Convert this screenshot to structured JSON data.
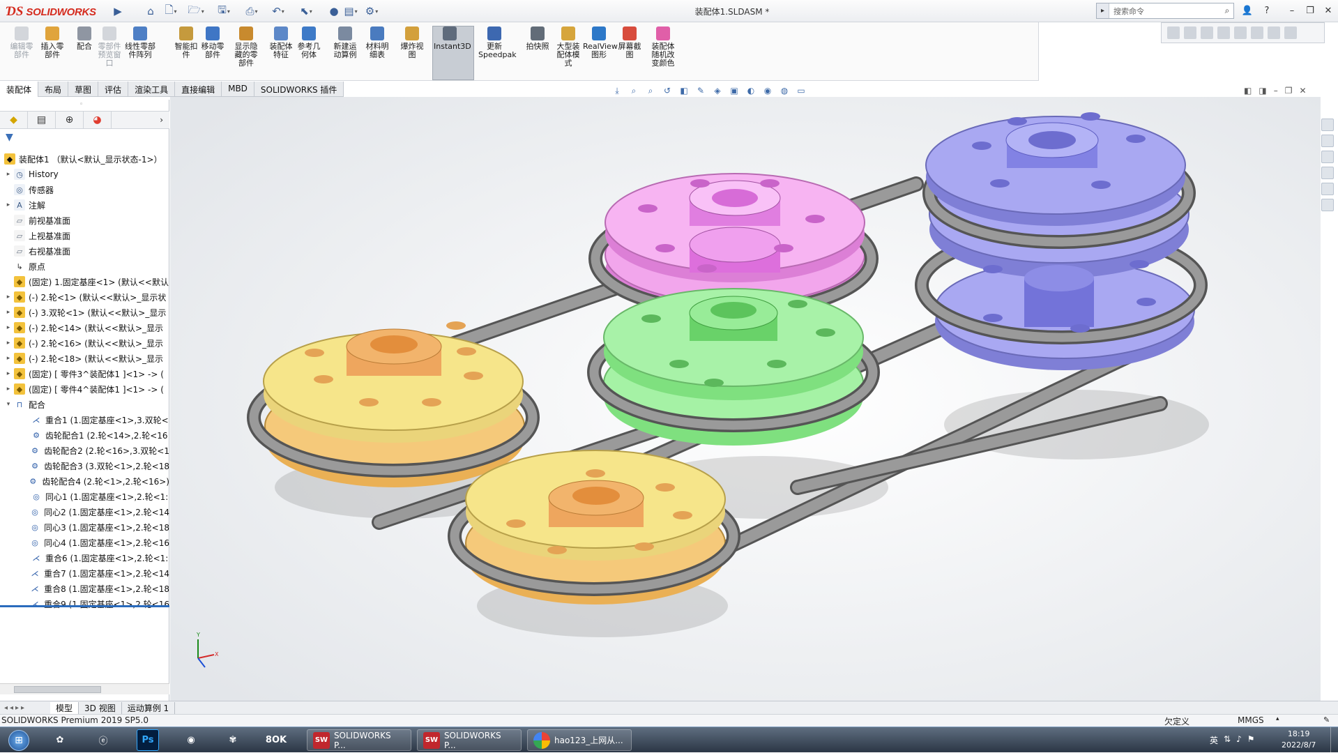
{
  "app": {
    "logo_text": "SOLIDWORKS",
    "document_title": "装配体1.SLDASM *",
    "search_placeholder": "搜索命令"
  },
  "ribbon": {
    "buttons": [
      {
        "label": "编辑零\n部件",
        "icon": "edit-component-icon",
        "disabled": true
      },
      {
        "label": "插入零\n部件",
        "icon": "insert-component-icon",
        "disabled": false
      },
      {
        "label": "配合",
        "icon": "mate-icon",
        "disabled": false
      },
      {
        "label": "零部件\n预览窗\n口",
        "icon": "component-preview-icon",
        "disabled": true
      },
      {
        "label": "线性零部\n件阵列",
        "icon": "linear-pattern-icon",
        "disabled": false
      },
      {
        "label": "智能扣\n件",
        "icon": "smart-fasteners-icon",
        "disabled": false
      },
      {
        "label": "移动零\n部件",
        "icon": "move-component-icon",
        "disabled": false
      },
      {
        "label": "显示隐\n藏的零\n部件",
        "icon": "show-hidden-icon",
        "disabled": false
      },
      {
        "label": "装配体\n特征",
        "icon": "assembly-features-icon",
        "disabled": false
      },
      {
        "label": "参考几\n何体",
        "icon": "reference-geometry-icon",
        "disabled": false
      },
      {
        "label": "新建运\n动算例",
        "icon": "new-motion-study-icon",
        "disabled": false
      },
      {
        "label": "材料明\n细表",
        "icon": "bill-of-materials-icon",
        "disabled": false
      },
      {
        "label": "爆炸视\n图",
        "icon": "exploded-view-icon",
        "disabled": false
      },
      {
        "label": "Instant3D",
        "icon": "instant3d-icon",
        "disabled": false
      },
      {
        "label": "更新\nSpeedpak",
        "icon": "speedpak-icon",
        "disabled": false
      },
      {
        "label": "拍快照",
        "icon": "snapshot-icon",
        "disabled": false
      },
      {
        "label": "大型装\n配体模\n式",
        "icon": "large-assembly-icon",
        "disabled": false
      },
      {
        "label": "RealView\n图形",
        "icon": "realview-icon",
        "disabled": false
      },
      {
        "label": "屏幕截\n图",
        "icon": "screen-capture-icon",
        "disabled": false
      },
      {
        "label": "装配体\n随机改\n变颜色",
        "icon": "random-color-icon",
        "disabled": false
      }
    ]
  },
  "command_tabs": [
    "装配体",
    "布局",
    "草图",
    "评估",
    "渲染工具",
    "直接编辑",
    "MBD",
    "SOLIDWORKS 插件"
  ],
  "tree": {
    "root": "装配体1 （默认<默认_显示状态-1>）",
    "items": [
      {
        "label": "History",
        "icon": "history-icon",
        "indent": 1,
        "expander": "▸"
      },
      {
        "label": "传感器",
        "icon": "sensor-icon",
        "indent": 1,
        "expander": ""
      },
      {
        "label": "注解",
        "icon": "annotation-icon",
        "indent": 1,
        "expander": "▸"
      },
      {
        "label": "前视基准面",
        "icon": "plane-icon",
        "indent": 1,
        "expander": ""
      },
      {
        "label": "上视基准面",
        "icon": "plane-icon",
        "indent": 1,
        "expander": ""
      },
      {
        "label": "右视基准面",
        "icon": "plane-icon",
        "indent": 1,
        "expander": ""
      },
      {
        "label": "原点",
        "icon": "origin-icon",
        "indent": 1,
        "expander": ""
      },
      {
        "label": "(固定) 1.固定基座<1> (默认<<默认",
        "icon": "part-icon",
        "indent": 1,
        "expander": ""
      },
      {
        "label": "(-) 2.轮<1> (默认<<默认>_显示状",
        "icon": "part-icon",
        "indent": 1,
        "expander": "▸"
      },
      {
        "label": "(-) 3.双轮<1> (默认<<默认>_显示",
        "icon": "part-icon",
        "indent": 1,
        "expander": "▸"
      },
      {
        "label": "(-) 2.轮<14> (默认<<默认>_显示",
        "icon": "part-icon",
        "indent": 1,
        "expander": "▸"
      },
      {
        "label": "(-) 2.轮<16> (默认<<默认>_显示",
        "icon": "part-icon",
        "indent": 1,
        "expander": "▸"
      },
      {
        "label": "(-) 2.轮<18> (默认<<默认>_显示",
        "icon": "part-icon",
        "indent": 1,
        "expander": "▸"
      },
      {
        "label": "(固定) [ 零件3^装配体1 ]<1> -> (",
        "icon": "part-icon",
        "indent": 1,
        "expander": "▸"
      },
      {
        "label": "(固定) [ 零件4^装配体1 ]<1> -> (",
        "icon": "part-icon",
        "indent": 1,
        "expander": "▸"
      },
      {
        "label": "配合",
        "icon": "mates-folder-icon",
        "indent": 1,
        "expander": "▾"
      },
      {
        "label": "重合1 (1.固定基座<1>,3.双轮<",
        "icon": "coincident-icon",
        "indent": 2,
        "expander": ""
      },
      {
        "label": "齿轮配合1 (2.轮<14>,2.轮<16",
        "icon": "gear-mate-icon",
        "indent": 2,
        "expander": ""
      },
      {
        "label": "齿轮配合2 (2.轮<16>,3.双轮<1",
        "icon": "gear-mate-icon",
        "indent": 2,
        "expander": ""
      },
      {
        "label": "齿轮配合3 (3.双轮<1>,2.轮<18",
        "icon": "gear-mate-icon",
        "indent": 2,
        "expander": ""
      },
      {
        "label": "齿轮配合4 (2.轮<1>,2.轮<16>)",
        "icon": "gear-mate-icon",
        "indent": 2,
        "expander": ""
      },
      {
        "label": "同心1 (1.固定基座<1>,2.轮<1:",
        "icon": "concentric-icon",
        "indent": 2,
        "expander": ""
      },
      {
        "label": "同心2 (1.固定基座<1>,2.轮<14",
        "icon": "concentric-icon",
        "indent": 2,
        "expander": ""
      },
      {
        "label": "同心3 (1.固定基座<1>,2.轮<18",
        "icon": "concentric-icon",
        "indent": 2,
        "expander": ""
      },
      {
        "label": "同心4 (1.固定基座<1>,2.轮<16",
        "icon": "concentric-icon",
        "indent": 2,
        "expander": ""
      },
      {
        "label": "重合6 (1.固定基座<1>,2.轮<1:",
        "icon": "coincident-icon",
        "indent": 2,
        "expander": ""
      },
      {
        "label": "重合7 (1.固定基座<1>,2.轮<14",
        "icon": "coincident-icon",
        "indent": 2,
        "expander": ""
      },
      {
        "label": "重合8 (1.固定基座<1>,2.轮<18",
        "icon": "coincident-icon",
        "indent": 2,
        "expander": ""
      },
      {
        "label": "重合9 (1.固定基座<1>,2.轮<16",
        "icon": "coincident-icon",
        "indent": 2,
        "expander": ""
      }
    ]
  },
  "bottom_tabs": [
    "模型",
    "3D 视图",
    "运动算例 1"
  ],
  "status": {
    "product": "SOLIDWORKS Premium 2019 SP5.0",
    "definition": "欠定义",
    "units": "MMGS"
  },
  "taskbar": {
    "apps": [
      {
        "label": "SOLIDWORKS P...",
        "badge": "SW"
      },
      {
        "label": "SOLIDWORKS P...",
        "badge": "SW"
      },
      {
        "label": "hao123_上网从...",
        "badge": ""
      }
    ],
    "time": "18:19",
    "date": "2022/8/7"
  },
  "colors": {
    "yellow_pulley": "#f4e27a",
    "pink_pulley": "#f4a8ee",
    "green_pulley": "#a8f2a8",
    "blue_pulley": "#a9a8f2",
    "belt": "#8e8e8e"
  }
}
